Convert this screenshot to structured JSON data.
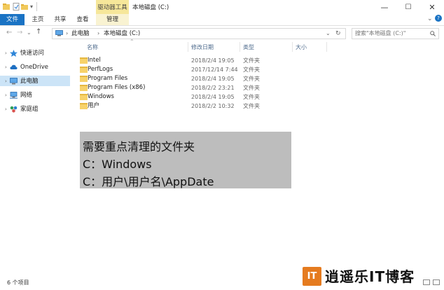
{
  "window": {
    "title": "本地磁盘 (C:)",
    "context_tab": "驱动器工具",
    "minimize": "—",
    "maximize": "☐",
    "close": "✕"
  },
  "ribbon": {
    "tabs": [
      "文件",
      "主页",
      "共享",
      "查看",
      "管理"
    ]
  },
  "address": {
    "path": [
      "此电脑",
      "本地磁盘 (C:)"
    ],
    "search_placeholder": "搜索\"本地磁盘 (C:)\""
  },
  "sidebar": {
    "items": [
      {
        "label": "快速访问",
        "icon": "star-icon"
      },
      {
        "label": "OneDrive",
        "icon": "cloud-icon"
      },
      {
        "label": "此电脑",
        "icon": "computer-icon"
      },
      {
        "label": "网络",
        "icon": "network-icon"
      },
      {
        "label": "家庭组",
        "icon": "homegroup-icon"
      }
    ]
  },
  "columns": [
    "名称",
    "修改日期",
    "类型",
    "大小"
  ],
  "files": [
    {
      "name": "Intel",
      "date": "2018/2/4 19:05",
      "type": "文件夹"
    },
    {
      "name": "PerfLogs",
      "date": "2017/12/14 7:44",
      "type": "文件夹"
    },
    {
      "name": "Program Files",
      "date": "2018/2/4 19:05",
      "type": "文件夹"
    },
    {
      "name": "Program Files (x86)",
      "date": "2018/2/2 23:21",
      "type": "文件夹"
    },
    {
      "name": "Windows",
      "date": "2018/2/4 19:05",
      "type": "文件夹"
    },
    {
      "name": "用户",
      "date": "2018/2/2 10:32",
      "type": "文件夹"
    }
  ],
  "note": {
    "lines": [
      "需要重点清理的文件夹",
      "C：Windows",
      "C：用户\\用户名\\AppDate"
    ]
  },
  "status": "6 个项目",
  "watermark": {
    "logo": "IT",
    "text": "逍遥乐IT博客"
  },
  "colors": {
    "accent": "#1a73c4",
    "context_tab": "#f6e79a",
    "selection": "#cce4f7",
    "folder": "#f7d26a",
    "note_bg": "#bdbdbd",
    "watermark": "#e57b1f"
  }
}
